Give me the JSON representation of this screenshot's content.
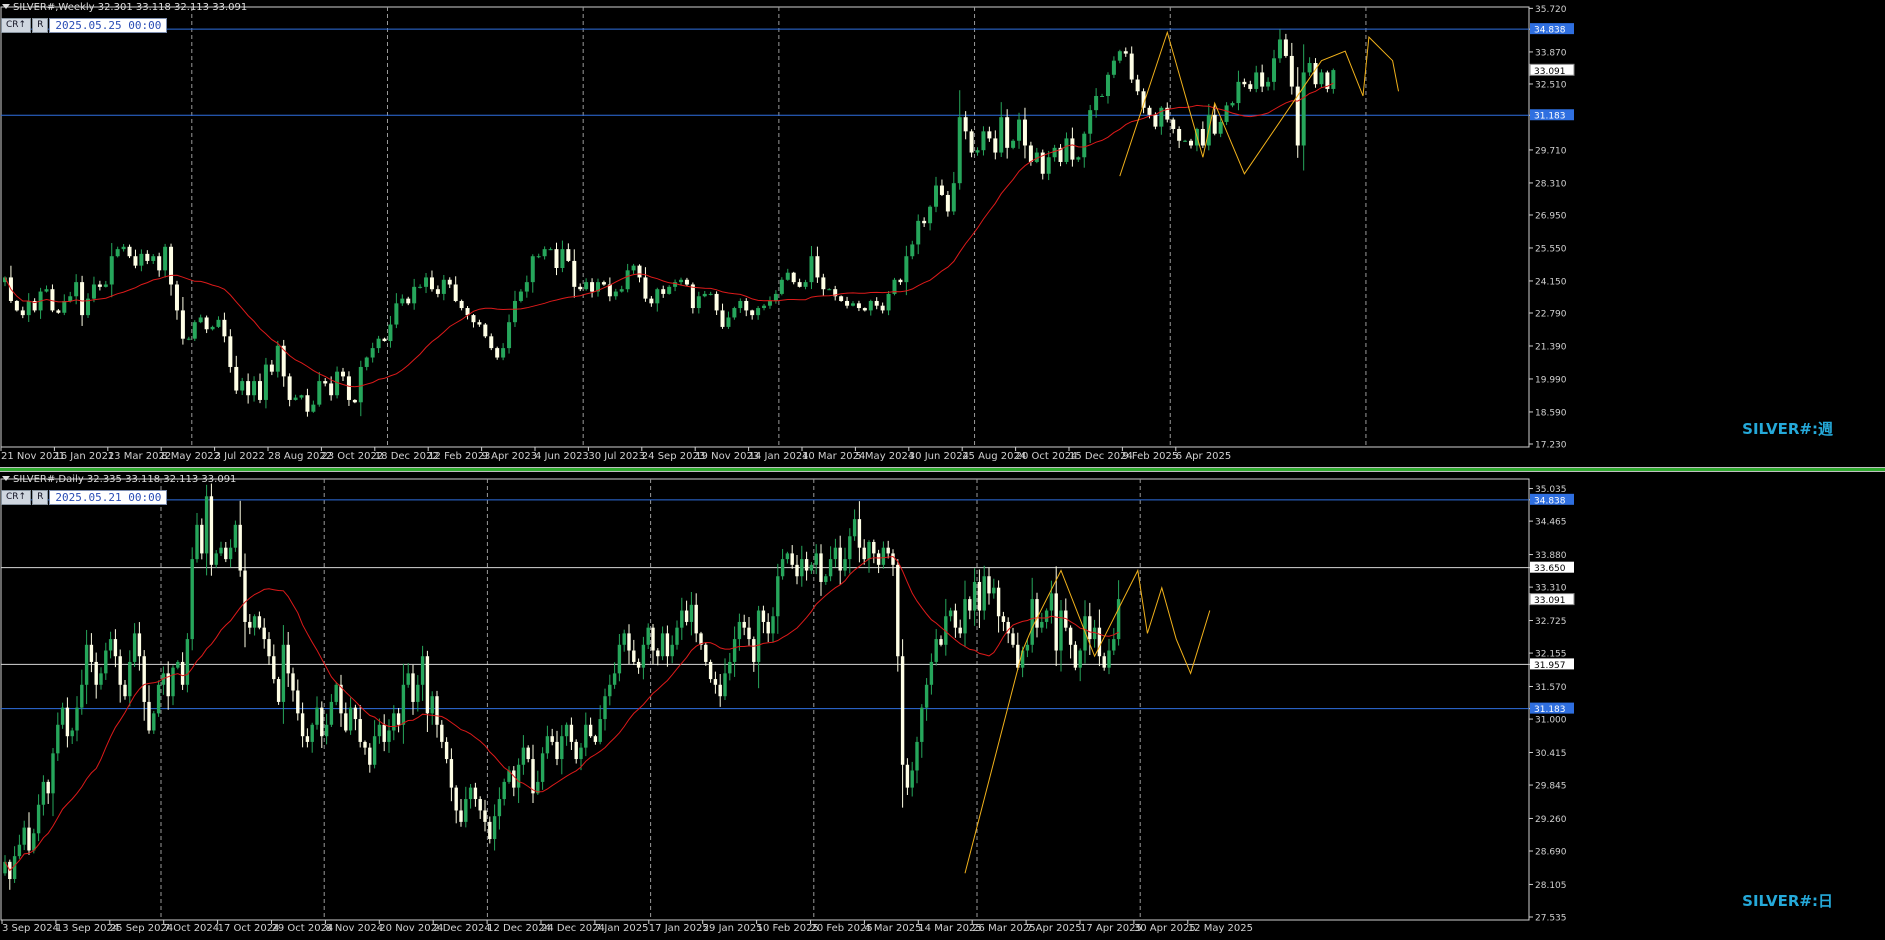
{
  "colors": {
    "background": "#000000",
    "bull": "#26a65b",
    "bear": "#ffffe6",
    "ma": "#dd1a1a",
    "zigzag": "#f2b21b",
    "blue_line": "#2f6fe0",
    "white_line": "#d8d8d8",
    "watermark": "#25a9d9"
  },
  "chart_data": [
    {
      "type": "candlestick",
      "symbol_info": "SILVER#,Weekly  32.301 33.118 32.113 33.091",
      "badges": [
        "CR↑",
        "R"
      ],
      "cursor_time": "2025.05.25 00:00",
      "watermark": "SILVER#:週",
      "ylim": [
        17.23,
        35.65
      ],
      "price_ticks": [
        "35.720",
        "34.838",
        "33.870",
        "33.091",
        "32.510",
        "31.183",
        "29.710",
        "28.310",
        "26.950",
        "25.550",
        "24.150",
        "22.790",
        "21.390",
        "19.990",
        "18.590",
        "17.230"
      ],
      "time_labels": [
        "21 Nov 2021",
        "16 Jan 2022",
        "13 Mar 2022",
        "8 May 2022",
        "3 Jul 2022",
        "28 Aug 2022",
        "23 Oct 2022",
        "18 Dec 2022",
        "12 Feb 2023",
        "9 Apr 2023",
        "4 Jun 2023",
        "30 Jul 2023",
        "24 Sep 2023",
        "19 Nov 2023",
        "14 Jan 2024",
        "10 Mar 2024",
        "5 May 2024",
        "30 Jun 2024",
        "25 Aug 2024",
        "20 Oct 2024",
        "15 Dec 2024",
        "9 Feb 2025",
        "6 Apr 2025"
      ],
      "hlines": [
        {
          "price": 34.838,
          "label": "34.838",
          "kind": "blue"
        },
        {
          "price": 31.183,
          "label": "31.183",
          "kind": "blue"
        }
      ],
      "last_price": {
        "price": 33.091,
        "label": "33.091"
      },
      "ma_period": 20,
      "zigzag": [
        {
          "i": 188,
          "p": 28.6
        },
        {
          "i": 196,
          "p": 34.7
        },
        {
          "i": 202,
          "p": 29.4
        },
        {
          "i": 204,
          "p": 31.7
        },
        {
          "i": 209,
          "p": 28.7
        },
        {
          "i": 222,
          "p": 33.5
        },
        {
          "i": 226,
          "p": 33.9
        },
        {
          "i": 229,
          "p": 32.0
        },
        {
          "i": 230,
          "p": 34.5
        },
        {
          "i": 234,
          "p": 33.5
        },
        {
          "i": 235,
          "p": 32.2
        }
      ],
      "closes": [
        24.3,
        23.3,
        22.9,
        22.7,
        23.3,
        22.9,
        23.7,
        23.8,
        22.9,
        22.8,
        23.3,
        23.5,
        24.1,
        22.7,
        23.4,
        24.0,
        23.9,
        24.0,
        25.2,
        25.5,
        25.6,
        25.2,
        24.8,
        25.3,
        25.0,
        25.2,
        24.6,
        25.6,
        24.0,
        22.9,
        21.7,
        21.7,
        22.4,
        22.6,
        22.1,
        22.2,
        22.5,
        21.8,
        20.5,
        19.5,
        19.9,
        19.3,
        19.9,
        19.1,
        20.6,
        20.3,
        21.4,
        20.1,
        19.1,
        19.2,
        19.3,
        18.6,
        18.9,
        19.9,
        19.8,
        19.3,
        20.3,
        20.1,
        19.1,
        19.0,
        20.5,
        20.9,
        21.3,
        21.7,
        21.6,
        22.3,
        23.2,
        23.4,
        23.2,
        23.9,
        23.9,
        24.3,
        23.8,
        23.6,
        24.2,
        24.0,
        23.3,
        23.0,
        22.7,
        22.4,
        22.3,
        21.8,
        21.3,
        20.9,
        21.3,
        22.4,
        23.3,
        23.7,
        24.1,
        25.2,
        25.2,
        25.5,
        25.5,
        24.7,
        25.5,
        25.0,
        23.9,
        23.8,
        24.1,
        23.7,
        24.1,
        24.0,
        23.5,
        23.7,
        23.8,
        24.6,
        24.8,
        24.3,
        23.4,
        23.2,
        23.8,
        23.6,
        23.9,
        24.1,
        24.2,
        24.0,
        23.0,
        23.5,
        23.6,
        23.6,
        22.9,
        22.2,
        22.6,
        23.0,
        23.3,
        22.9,
        22.7,
        23.0,
        23.1,
        23.3,
        23.6,
        24.2,
        24.5,
        24.1,
        23.9,
        24.1,
        25.2,
        24.3,
        23.8,
        23.8,
        23.5,
        23.3,
        23.1,
        23.2,
        23.0,
        22.9,
        23.3,
        23.1,
        22.9,
        23.6,
        24.2,
        24.1,
        25.2,
        25.7,
        26.7,
        26.6,
        27.3,
        28.2,
        27.8,
        27.1,
        28.3,
        31.1,
        30.5,
        29.6,
        29.7,
        30.5,
        30.2,
        29.6,
        31.1,
        29.8,
        30.1,
        31.0,
        29.9,
        29.2,
        29.6,
        28.7,
        29.4,
        29.8,
        29.2,
        30.2,
        29.3,
        29.4,
        30.4,
        31.4,
        32.0,
        32.0,
        32.9,
        33.5,
        33.9,
        33.8,
        32.7,
        32.2,
        31.5,
        31.2,
        30.7,
        31.5,
        31.0,
        30.6,
        30.1,
        30.1,
        29.9,
        30.6,
        29.9,
        31.2,
        30.4,
        30.9,
        31.6,
        31.7,
        32.6,
        32.5,
        32.3,
        33.0,
        32.4,
        32.6,
        33.6,
        34.4,
        33.7,
        32.4,
        29.9,
        33.0,
        33.4,
        32.5,
        33.0,
        32.3,
        33.1
      ]
    },
    {
      "type": "candlestick",
      "symbol_info": "SILVER#,Daily  32.335 33.118 32.113 33.091",
      "badges": [
        "CR↑",
        "R"
      ],
      "cursor_time": "2025.05.21 00:00",
      "watermark": "SILVER#:日",
      "ylim": [
        27.535,
        35.15
      ],
      "price_ticks": [
        "35.035",
        "34.838",
        "34.465",
        "33.880",
        "33.650",
        "33.310",
        "33.091",
        "32.725",
        "32.155",
        "31.957",
        "31.570",
        "31.183",
        "31.000",
        "30.415",
        "29.845",
        "29.260",
        "28.690",
        "28.105",
        "27.535"
      ],
      "time_labels": [
        "3 Sep 2024",
        "13 Sep 2024",
        "25 Sep 2024",
        "7 Oct 2024",
        "17 Oct 2024",
        "29 Oct 2024",
        "8 Nov 2024",
        "20 Nov 2024",
        "2 Dec 2024",
        "12 Dec 2024",
        "24 Dec 2024",
        "7 Jan 2025",
        "17 Jan 2025",
        "29 Jan 2025",
        "10 Feb 2025",
        "20 Feb 2025",
        "4 Mar 2025",
        "14 Mar 2025",
        "26 Mar 2025",
        "7 Apr 2025",
        "17 Apr 2025",
        "30 Apr 2025",
        "12 May 2025"
      ],
      "hlines": [
        {
          "price": 34.838,
          "label": "34.838",
          "kind": "blue"
        },
        {
          "price": 33.65,
          "label": "33.650",
          "kind": "white"
        },
        {
          "price": 31.957,
          "label": "31.957",
          "kind": "white"
        },
        {
          "price": 31.183,
          "label": "31.183",
          "kind": "blue"
        }
      ],
      "last_price": {
        "price": 33.091,
        "label": "33.091"
      },
      "ma_period": 20,
      "zigzag": [
        {
          "i": 200,
          "p": 28.3
        },
        {
          "i": 212,
          "p": 32.2
        },
        {
          "i": 214,
          "p": 32.6
        },
        {
          "i": 220,
          "p": 33.6
        },
        {
          "i": 227,
          "p": 32.1
        },
        {
          "i": 236,
          "p": 33.6
        },
        {
          "i": 238,
          "p": 32.5
        },
        {
          "i": 241,
          "p": 33.3
        },
        {
          "i": 244,
          "p": 32.4
        },
        {
          "i": 247,
          "p": 31.8
        },
        {
          "i": 251,
          "p": 32.9
        }
      ],
      "closes": [
        28.5,
        28.2,
        28.6,
        28.8,
        29.1,
        28.7,
        29.0,
        29.5,
        29.9,
        29.7,
        30.4,
        30.9,
        31.2,
        30.7,
        30.8,
        31.2,
        31.6,
        32.3,
        32.0,
        31.6,
        31.8,
        32.2,
        32.4,
        32.1,
        31.6,
        31.4,
        32.0,
        32.5,
        32.1,
        31.3,
        30.8,
        31.1,
        31.6,
        31.8,
        31.4,
        31.9,
        32.0,
        31.6,
        32.4,
        33.8,
        34.4,
        33.9,
        34.9,
        33.7,
        33.9,
        34.0,
        33.8,
        34.0,
        34.4,
        33.6,
        32.7,
        32.6,
        32.8,
        32.6,
        32.4,
        32.1,
        31.7,
        31.3,
        32.3,
        31.8,
        31.5,
        31.1,
        30.7,
        30.6,
        30.9,
        31.2,
        30.7,
        30.9,
        31.3,
        31.6,
        31.1,
        30.8,
        31.2,
        31.0,
        30.6,
        30.5,
        30.2,
        30.7,
        30.9,
        30.6,
        30.8,
        31.1,
        30.9,
        31.6,
        31.8,
        31.3,
        31.6,
        32.1,
        31.1,
        31.4,
        30.9,
        30.6,
        30.3,
        29.8,
        29.4,
        29.2,
        29.6,
        29.8,
        29.6,
        29.4,
        29.2,
        28.9,
        29.3,
        29.6,
        29.9,
        30.1,
        29.8,
        30.2,
        30.5,
        30.3,
        29.7,
        29.9,
        30.4,
        30.7,
        30.6,
        30.3,
        30.7,
        30.9,
        30.6,
        30.3,
        30.5,
        30.9,
        30.7,
        30.6,
        31.0,
        31.4,
        31.6,
        31.8,
        32.3,
        32.5,
        32.2,
        32.0,
        31.9,
        32.3,
        32.6,
        32.2,
        32.1,
        32.5,
        32.1,
        32.3,
        32.6,
        32.9,
        32.7,
        33.0,
        32.5,
        32.3,
        32.0,
        31.7,
        31.6,
        31.4,
        31.8,
        32.0,
        32.4,
        32.7,
        32.6,
        32.4,
        32.0,
        32.9,
        32.7,
        32.5,
        32.8,
        33.5,
        33.8,
        33.9,
        33.7,
        33.5,
        33.8,
        33.6,
        33.7,
        33.9,
        33.4,
        33.5,
        33.8,
        34.0,
        33.6,
        33.8,
        34.2,
        34.5,
        34.0,
        33.8,
        34.1,
        33.9,
        33.7,
        34.0,
        33.9,
        33.7,
        32.1,
        30.2,
        29.8,
        30.1,
        30.6,
        31.2,
        31.6,
        32.0,
        32.4,
        32.3,
        32.8,
        32.9,
        32.6,
        32.5,
        33.1,
        32.9,
        33.4,
        32.9,
        33.5,
        33.2,
        33.3,
        32.8,
        32.7,
        32.5,
        32.3,
        31.9,
        32.2,
        32.3,
        33.1,
        32.6,
        32.7,
        32.9,
        33.2,
        32.2,
        32.9,
        32.6,
        32.3,
        31.9,
        32.2,
        32.8,
        32.4,
        32.6,
        32.1,
        31.9,
        32.2,
        32.4,
        33.1
      ]
    }
  ]
}
